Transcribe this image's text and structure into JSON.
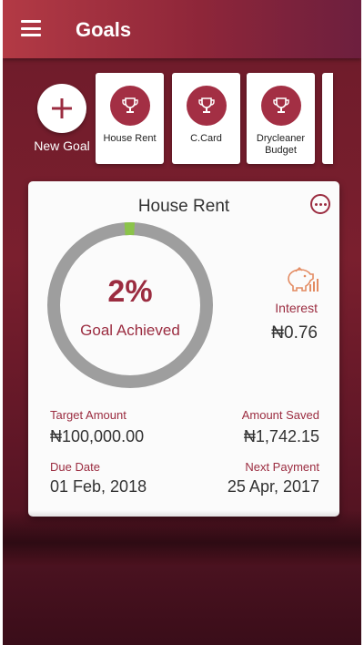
{
  "app": {
    "title": "Goals"
  },
  "new_goal": {
    "label": "New Goal"
  },
  "goals": [
    {
      "label": "House Rent",
      "icon": "trophy-icon"
    },
    {
      "label": "C.Card",
      "icon": "trophy-icon"
    },
    {
      "label": "Drycleaner Budget",
      "icon": "trophy-icon"
    }
  ],
  "detail": {
    "title": "House Rent",
    "progress_text": "2%",
    "progress_fraction": 0.02,
    "achieved_label": "Goal Achieved",
    "interest_label": "Interest",
    "interest_value": "₦0.76",
    "target_label": "Target Amount",
    "target_value": "₦100,000.00",
    "saved_label": "Amount Saved",
    "saved_value": "₦1,742.15",
    "due_label": "Due Date",
    "due_value": "01 Feb, 2018",
    "next_label": "Next Payment",
    "next_value": "25 Apr, 2017"
  },
  "colors": {
    "primary": "#9b2c40",
    "progress": "#8bc34a",
    "track": "#9e9e9e"
  }
}
